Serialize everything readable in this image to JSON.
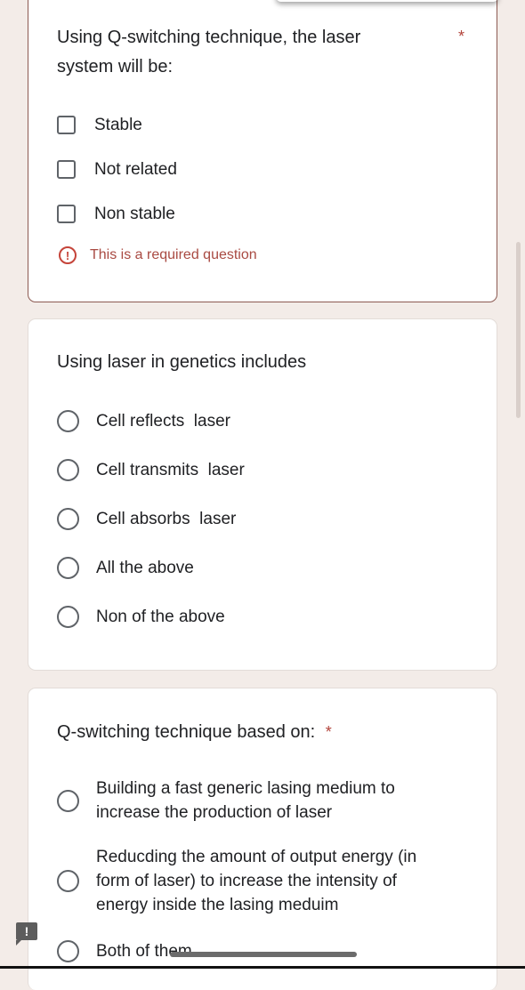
{
  "questions": [
    {
      "title": "Using Q-switching technique, the laser\nsystem will be:",
      "required": true,
      "required_marker": "*",
      "type": "checkbox",
      "options": [
        "Stable",
        "Not related",
        "Non stable"
      ],
      "error": {
        "icon": "!",
        "text": "This is a required question"
      }
    },
    {
      "title": "Using laser in genetics includes",
      "required": false,
      "type": "radio",
      "options": [
        "Cell reflects  laser",
        "Cell transmits  laser",
        "Cell absorbs  laser",
        "All the above",
        "Non of the above"
      ]
    },
    {
      "title": "Q-switching technique based on:",
      "required": true,
      "required_marker": "*",
      "type": "radio",
      "options": [
        "Building a fast generic lasing medium to\nincrease the production of laser",
        "Reducding the amount of output energy (in\nform of laser) to increase the intensity of\nenergy inside the lasing meduim",
        "Both of them"
      ]
    }
  ],
  "feedback_button": {
    "icon": "!"
  },
  "colors": {
    "page_bg": "#f3ece8",
    "card_bg": "#ffffff",
    "error_border": "#8c5a52",
    "error_red": "#c5443a",
    "required_star": "#b3443b",
    "text": "#202124",
    "control_gray": "#5f6368"
  }
}
